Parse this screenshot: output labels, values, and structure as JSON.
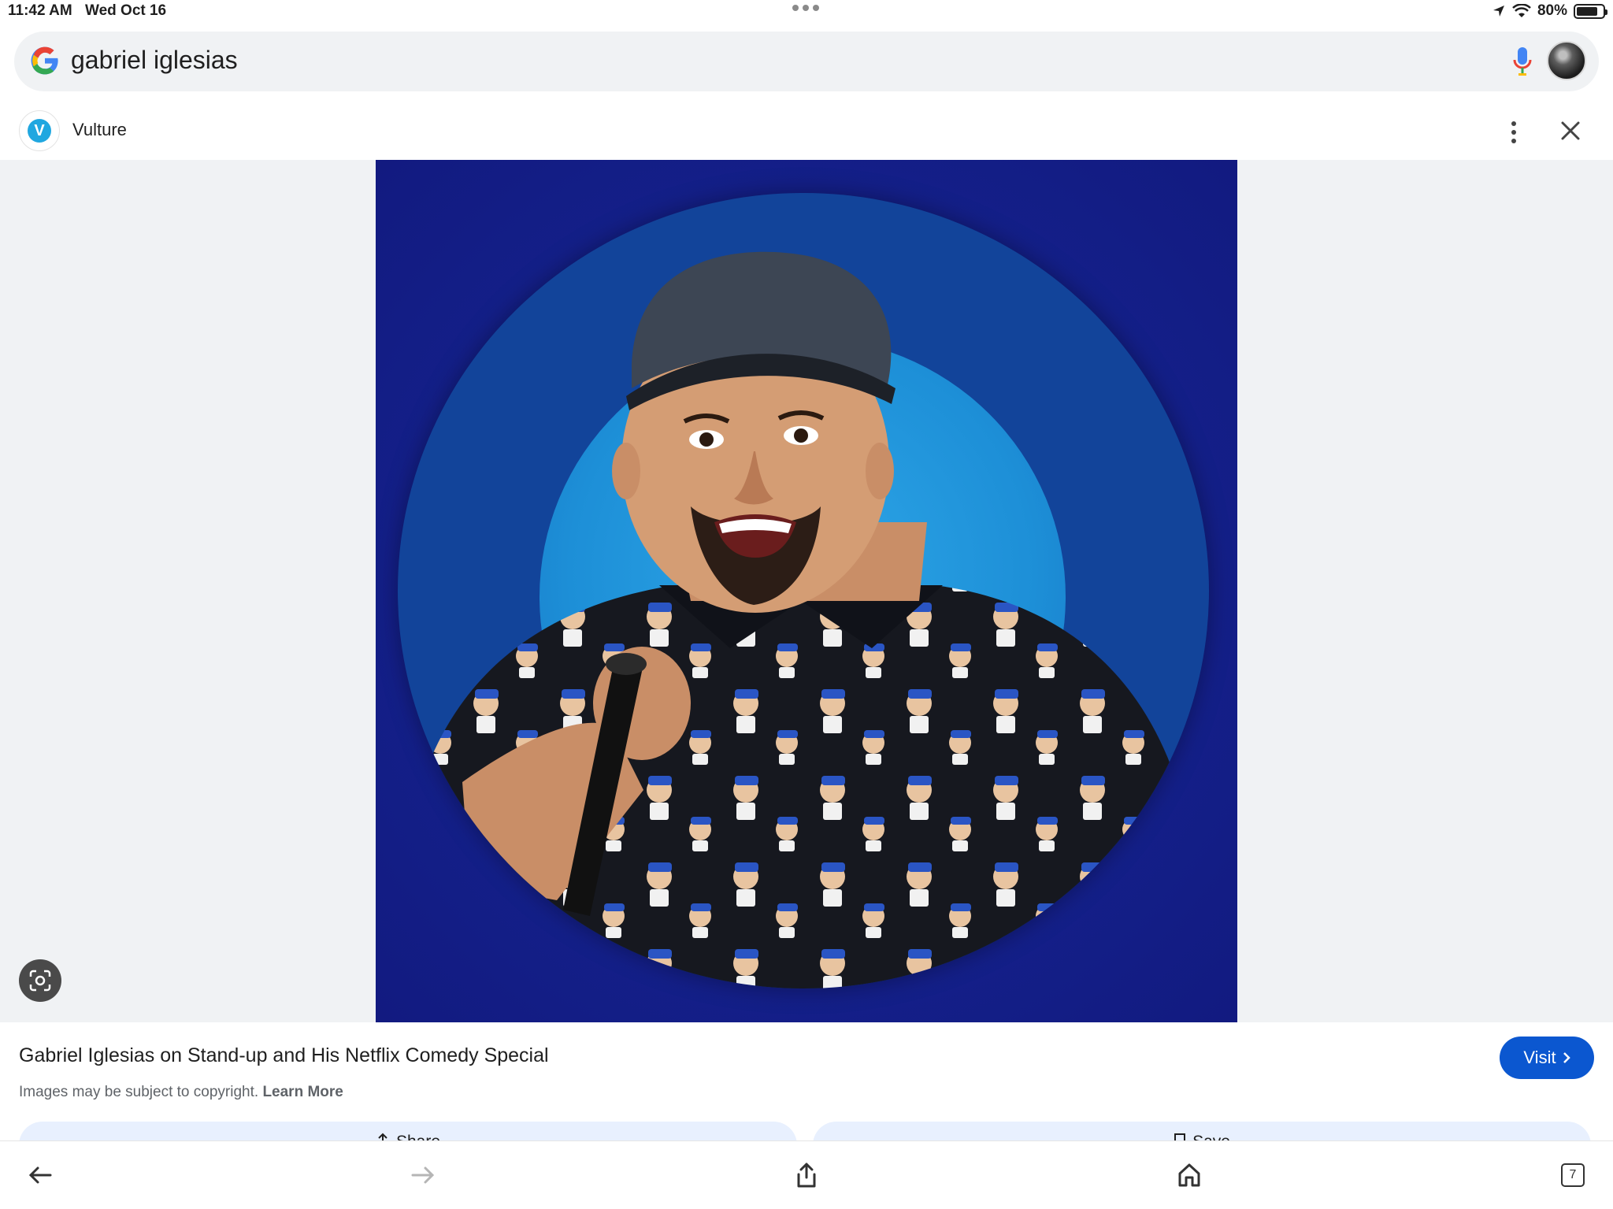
{
  "status": {
    "time": "11:42 AM",
    "date": "Wed Oct 16",
    "battery": "80%",
    "battery_level": 0.8
  },
  "search": {
    "query": "gabriel iglesias"
  },
  "source": {
    "initial": "V",
    "name": "Vulture"
  },
  "result": {
    "title": "Gabriel Iglesias on Stand-up and His Netflix Comedy Special",
    "copyright_text": "Images may be subject to copyright.",
    "learn_more": "Learn More",
    "visit_label": "Visit"
  },
  "actions": {
    "share_label": "Share",
    "save_label": "Save"
  },
  "toolbar": {
    "tab_count": "7"
  },
  "colors": {
    "accent": "#0b57d0",
    "image_background": "#14208a",
    "ring_outer": "#12449a",
    "ring_inner": "#2ea7e8"
  },
  "icons": [
    "location-icon",
    "wifi-icon",
    "battery-icon",
    "google-logo-icon",
    "mic-icon",
    "more-vert-icon",
    "close-icon",
    "lens-icon",
    "chevron-right-icon",
    "share-icon",
    "bookmark-icon",
    "back-icon",
    "forward-icon",
    "home-icon",
    "tabs-icon"
  ]
}
